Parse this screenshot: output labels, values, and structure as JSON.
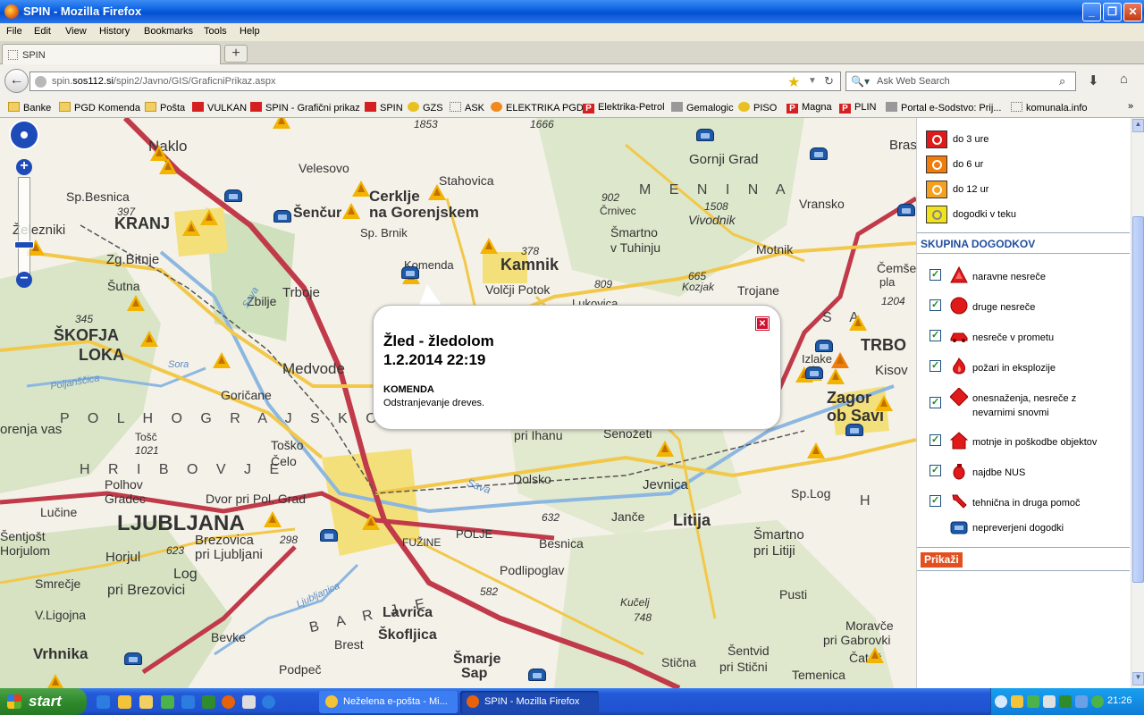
{
  "window": {
    "title": "SPIN - Mozilla Firefox"
  },
  "menu": [
    "File",
    "Edit",
    "View",
    "History",
    "Bookmarks",
    "Tools",
    "Help"
  ],
  "tab": {
    "label": "SPIN",
    "new_tab": "+"
  },
  "nav": {
    "url_host": "spin.sos112.si",
    "url_prefix": "spin.",
    "url_domain": "sos112.si",
    "url_path": "/spin2/Javno/GIS/GraficniPrikaz.aspx",
    "search_placeholder": "Ask Web Search"
  },
  "bookmarks": [
    "Banke",
    "PGD Komenda",
    "Pošta",
    "VULKAN",
    "SPIN - Grafični prikaz",
    "SPIN",
    "GZS",
    "ASK",
    "ELEKTRIKA PGD",
    "Elektrika-Petrol",
    "Gemalogic",
    "PISO",
    "Magna",
    "PLIN",
    "Portal e-Sodstvo: Prij...",
    "komunala.info"
  ],
  "bookmarks_more": "»",
  "map": {
    "places": {
      "naklo": "Naklo",
      "velesovo": "Velesovo",
      "stahovica": "Stahovica",
      "gornji_grad": "Gornji Grad",
      "bras": "Bras",
      "sp_besnica": "Sp.Besnica",
      "cerklje": "Cerklje",
      "na_gorenjskem": "na Gorenjskem",
      "sencur": "Šenčur",
      "kranj": "KRANJ",
      "zelezniki": "Železniki",
      "crnivec": "Črnivec",
      "vivodnik": "Vivodnik",
      "vransko": "Vransko",
      "sp_brnik": "Sp. Brnik",
      "smartno": "Šmartno",
      "v_tuhinju": "v Tuhinju",
      "motnik": "Motnik",
      "zg_bitnje": "Zg.Bitnje",
      "kamnik": "Kamnik",
      "komenda": "Komenda",
      "cemse": "Čemše",
      "sutna": "Šutna",
      "trboje": "Trboje",
      "volcji_potok": "Volčji Potok",
      "kozjak": "Kozjak",
      "trojane": "Trojane",
      "lukovica": "Lukovica",
      "zbilje": "Zbilje",
      "skofja": "ŠKOFJA",
      "loka": "LOKA",
      "trbo": "TRBO",
      "kisov": "Kisov",
      "izlake": "Izlake",
      "medvode": "Medvode",
      "zagor": "Zagor",
      "ob_savi": "ob Savi",
      "goricane": "Goričane",
      "orenja_vas": "orenja vas",
      "pri_ihanu": "pri Ihanu",
      "senozeti": "Senožeti",
      "toško": "Toško",
      "celo": "Čelo",
      "polhov": "Polhov",
      "gradec": "Gradec",
      "dvor": "Dvor pri Pol. Grad",
      "dolsko": "Dolsko",
      "jevnica": "Jevnica",
      "sp_log": "Sp.Log",
      "lucine": "Lučine",
      "ljubljana": "LJUBLJANA",
      "jance": "Janče",
      "litija": "Litija",
      "sentjost": "Šentjošt",
      "horjulom": "Horjulom",
      "brezovica": "Brezovica",
      "pri_ljubljani": "pri Ljubljani",
      "fuzine": "FUŽINE",
      "polje": "POLJE",
      "besnica": "Besnica",
      "smartno_pri": "Šmartno",
      "pri_litiji": "pri Litiji",
      "horjul": "Horjul",
      "log": "Log",
      "pri_brezovici": "pri Brezovici",
      "podlipoglav": "Podlipoglav",
      "smrecje": "Smrečje",
      "pusti": "Pusti",
      "v_ligojna": "V.Ligojna",
      "kucelj": "Kučelj",
      "moravce": "Moravče",
      "lavrica": "Lavrica",
      "pri_gabrovki": "pri Gabrovki",
      "vrhnika": "Vrhnika",
      "bevke": "Bevke",
      "skofljica": "Škofljica",
      "sentvid": "Šentvid",
      "catez": "Čatež",
      "brest": "Brest",
      "smarje": "Šmarje",
      "sap": "Sap",
      "sticna": "Stična",
      "pri_sticni": "pri Stični",
      "podpec": "Podpeč",
      "temenica": "Temenica"
    },
    "regions": {
      "menina": "M E N I N A",
      "polhograjsko": "P O L H O G R A J S K O",
      "hribovje": "H R I B O V J E",
      "barje": "B A R J E",
      "sava_region": "S A",
      "h": "H"
    },
    "elev": {
      "e1853": "1853",
      "e1666": "1666",
      "e397": "397",
      "e902": "902",
      "e1508": "1508",
      "e378": "378",
      "e809": "809",
      "e665": "665",
      "e1204": "1204",
      "e345": "345",
      "e1021": "1021",
      "e623": "623",
      "e298": "298",
      "e632": "632",
      "e582": "582",
      "e748": "748"
    },
    "rivers": {
      "sora": "Sora",
      "sava": "Sava",
      "sava2": "Sava",
      "poljanska": "Poljanščica",
      "ljubljanica": "Ljubljanica"
    }
  },
  "popup": {
    "title": "Žled - žledolom",
    "datetime": "1.2.2014 22:19",
    "location": "KOMENDA",
    "description": "Odstranjevanje dreves.",
    "close": "✕"
  },
  "legend": {
    "time": [
      {
        "label": "do 3 ure",
        "color": "#e01a1a"
      },
      {
        "label": "do 6 ur",
        "color": "#f07c0a"
      },
      {
        "label": "do 12 ur",
        "color": "#f5a01e"
      },
      {
        "label": "dogodki v teku",
        "color": "#f2e21c"
      }
    ],
    "section_title": "SKUPINA DOGODKOV",
    "categories": [
      "naravne nesreče",
      "druge nesreče",
      "nesreče v prometu",
      "požari in eksplozije",
      "onesnaženja, nesreče z",
      "nevarnimi snovmi",
      "motnje in poškodbe objektov",
      "najdbe NUS",
      "tehnična in druga pomoč",
      "nepreverjeni dogodki"
    ],
    "show_button": "Prikaži"
  },
  "taskbar": {
    "start": "start",
    "tasks": [
      "Neželena e-pošta - Mi...",
      "SPIN - Mozilla Firefox"
    ],
    "clock": "21:26"
  },
  "colors": {
    "accent": "#1f4e9e",
    "alert": "#e2501f",
    "event": "#f2b400"
  }
}
